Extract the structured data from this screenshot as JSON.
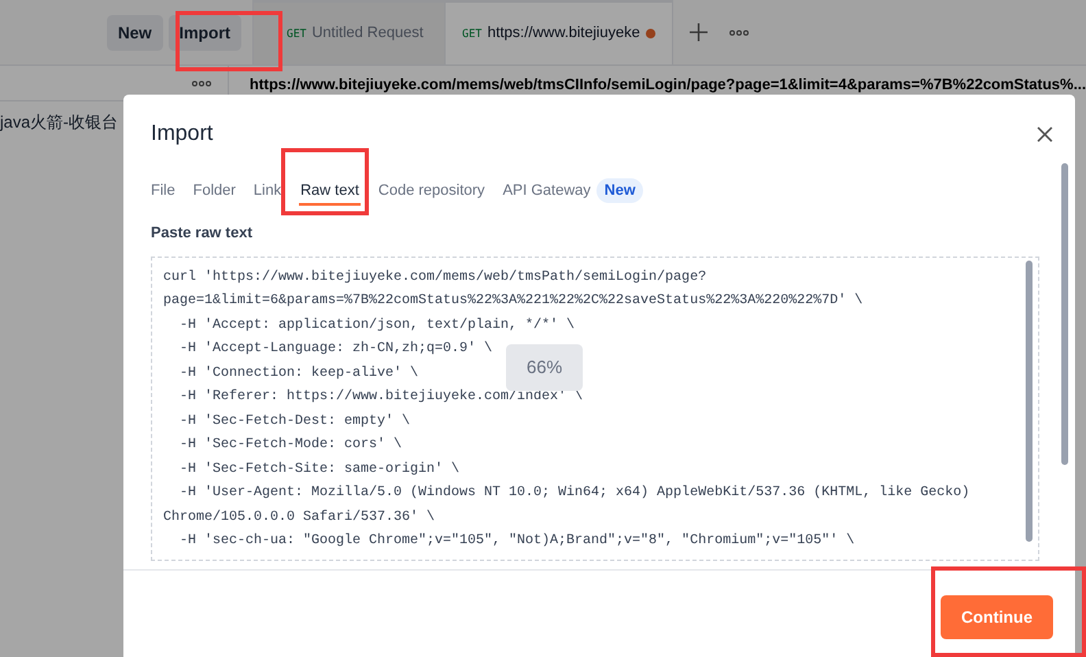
{
  "toolbar": {
    "new_button": "New",
    "import_button": "Import"
  },
  "request_tabs": [
    {
      "method": "GET",
      "label": "Untitled Request",
      "selected": false,
      "unsaved": false
    },
    {
      "method": "GET",
      "label": "https://www.bitejiuyeke",
      "selected": true,
      "unsaved": true
    }
  ],
  "sidebar": {
    "items": [
      "java火箭-收银台"
    ]
  },
  "request_url": "https://www.bitejiuyeke.com/mems/web/tmsCIInfo/semiLogin/page?page=1&limit=4&params=%7B%22comStatus%...",
  "dialog": {
    "title": "Import",
    "tabs": [
      {
        "label": "File",
        "selected": false
      },
      {
        "label": "Folder",
        "selected": false
      },
      {
        "label": "Link",
        "selected": false
      },
      {
        "label": "Raw text",
        "selected": true
      },
      {
        "label": "Code repository",
        "selected": false
      },
      {
        "label": "API Gateway",
        "selected": false,
        "badge": "New"
      }
    ],
    "field_label": "Paste raw text",
    "raw_text_lines": [
      "curl 'https://www.bitejiuyeke.com/mems/web/tmsPath/semiLogin/page?",
      "page=1&limit=6&params=%7B%22comStatus%22%3A%221%22%2C%22saveStatus%22%3A%220%22%7D' \\",
      "  -H 'Accept: application/json, text/plain, */*' \\",
      "  -H 'Accept-Language: zh-CN,zh;q=0.9' \\",
      "  -H 'Connection: keep-alive' \\",
      "  -H 'Referer: https://www.bitejiuyeke.com/index' \\",
      "  -H 'Sec-Fetch-Dest: empty' \\",
      "  -H 'Sec-Fetch-Mode: cors' \\",
      "  -H 'Sec-Fetch-Site: same-origin' \\",
      "  -H 'User-Agent: Mozilla/5.0 (Windows NT 10.0; Win64; x64) AppleWebKit/537.36 (KHTML, like Gecko)",
      "Chrome/105.0.0.0 Safari/537.36' \\",
      "  -H 'sec-ch-ua: \"Google Chrome\";v=\"105\", \"Not)A;Brand\";v=\"8\", \"Chromium\";v=\"105\"' \\"
    ],
    "zoom_indicator": "66%",
    "continue_button": "Continue"
  }
}
